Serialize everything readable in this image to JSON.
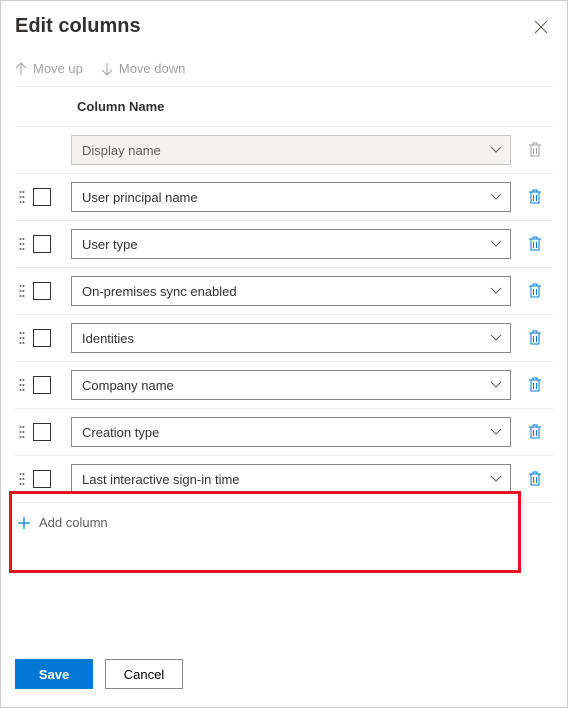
{
  "title": "Edit columns",
  "toolbar": {
    "move_up": "Move up",
    "move_down": "Move down"
  },
  "th": {
    "column_name": "Column Name"
  },
  "locked_row": {
    "label": "Display name"
  },
  "rows": [
    {
      "label": "User principal name"
    },
    {
      "label": "User type"
    },
    {
      "label": "On-premises sync enabled"
    },
    {
      "label": "Identities"
    },
    {
      "label": "Company name"
    },
    {
      "label": "Creation type"
    },
    {
      "label": "Last interactive sign-in time"
    }
  ],
  "add_column": "Add column",
  "buttons": {
    "save": "Save",
    "cancel": "Cancel"
  }
}
